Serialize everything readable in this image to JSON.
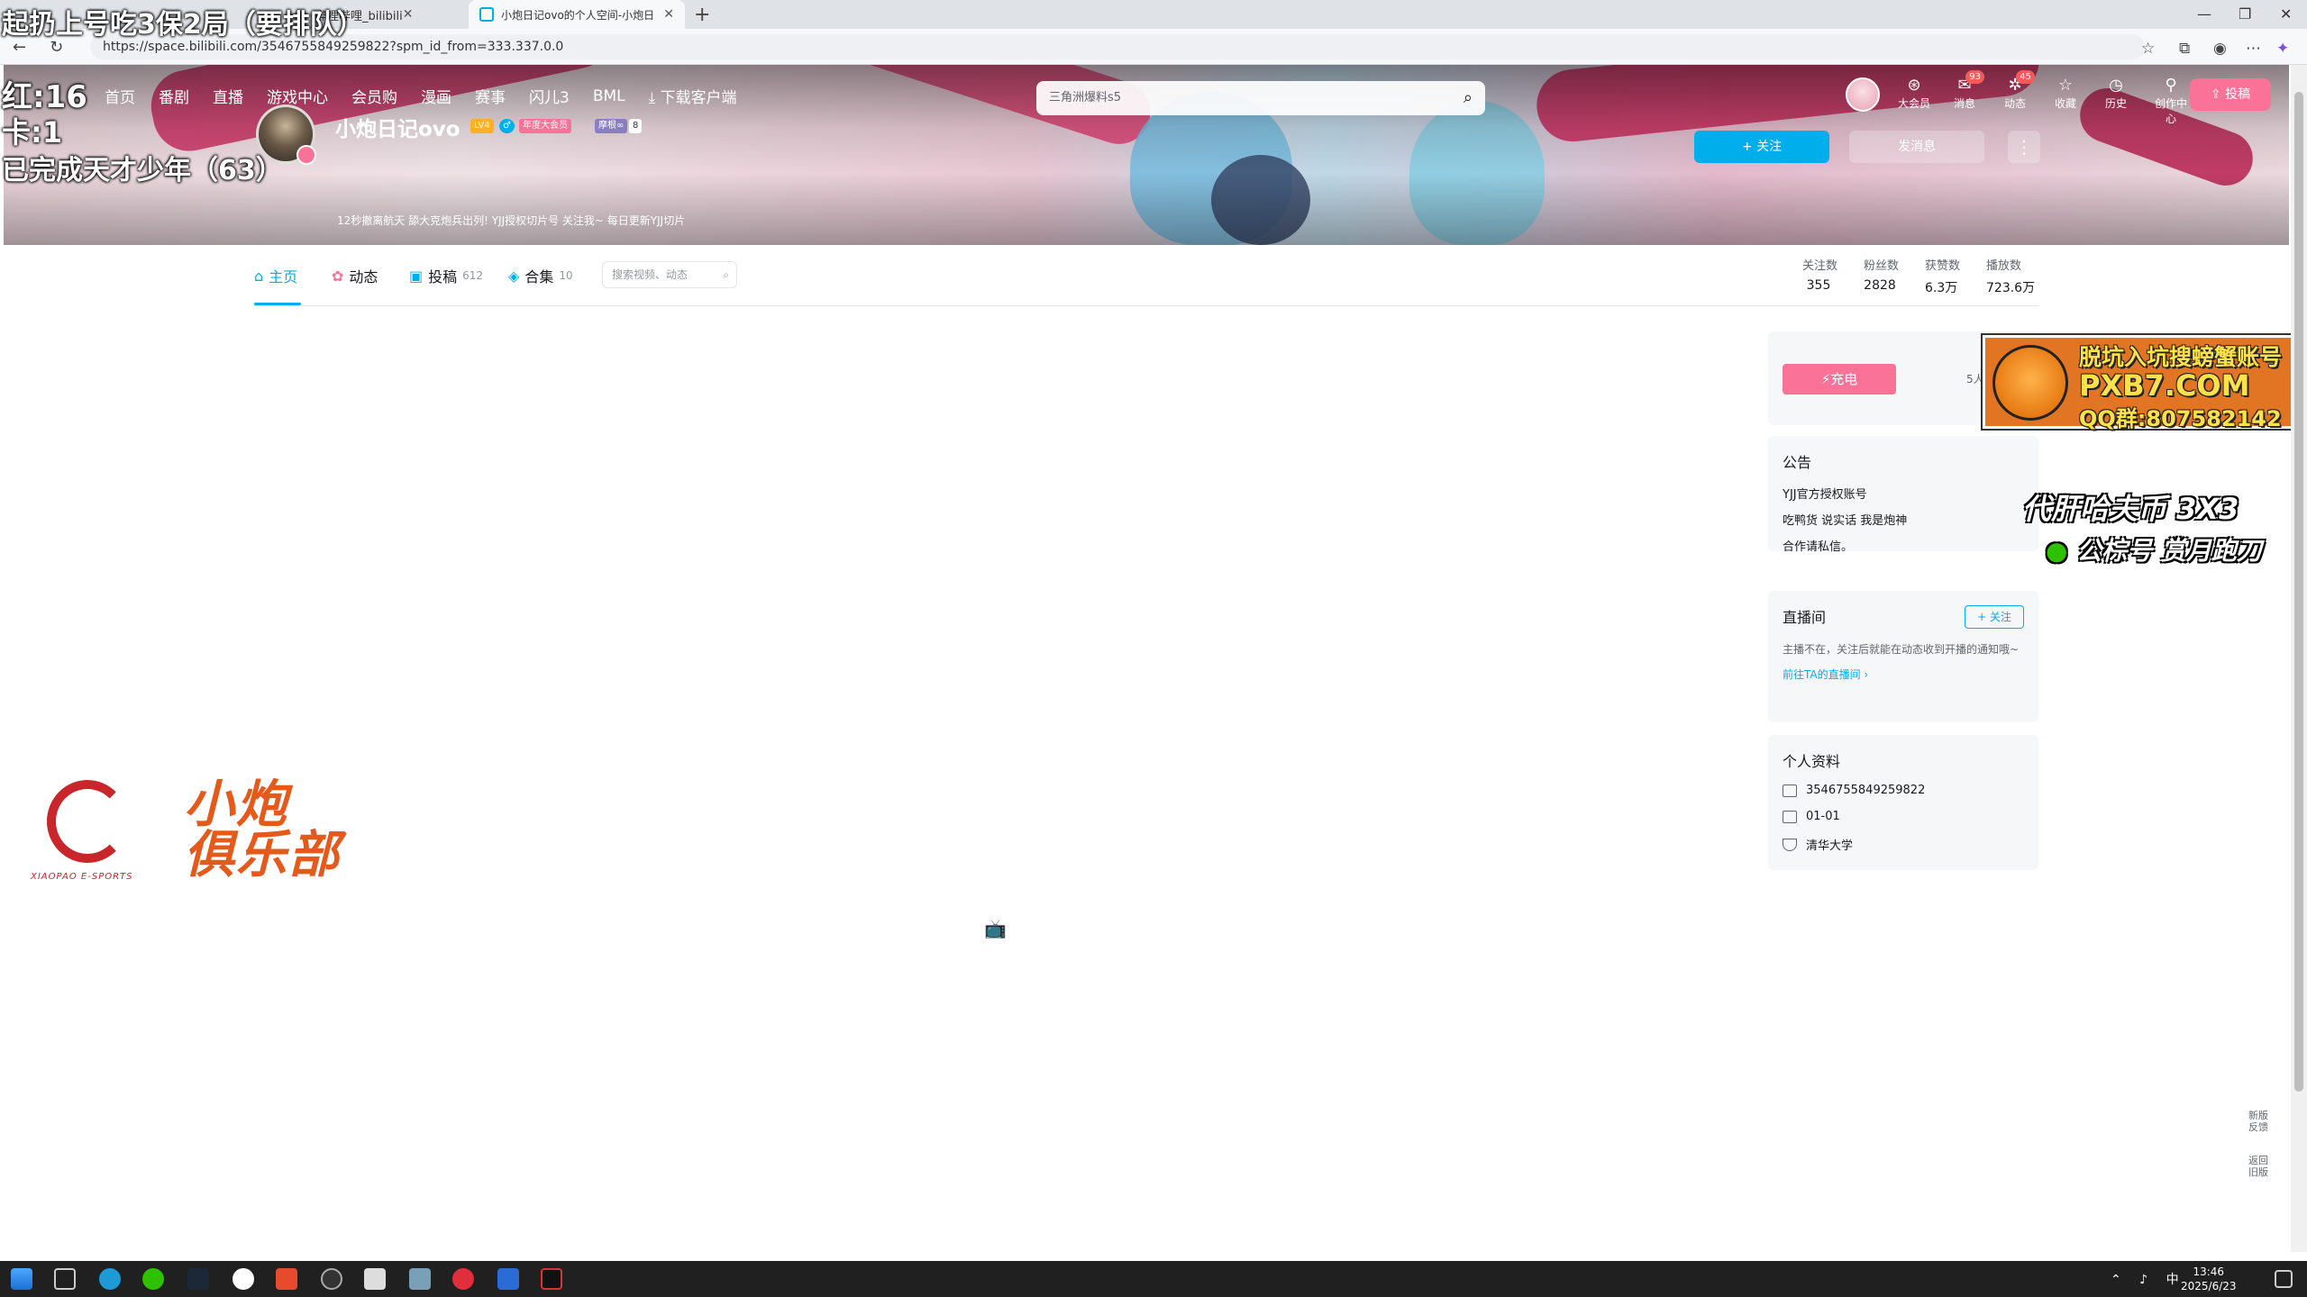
{
  "browser": {
    "tabs": [
      {
        "label": "哔哩哔哩 (゜-゜)つロ 干杯~-bilibili",
        "partial_label": "哔哩哔哩_bilibili"
      },
      {
        "label": "小炮日记ovo的个人空间-小炮日记"
      }
    ],
    "url": "https://space.bilibili.com/3546755849259822?spm_id_from=333.337.0.0"
  },
  "overlay": {
    "line1": "起扔上号吃3保2局（要排队）",
    "line2_label": "红:",
    "line2_value": "16",
    "line3_label": "卡:",
    "line3_value": "1",
    "line4": "已完成天才少年（63）"
  },
  "topnav": {
    "items": [
      "首页",
      "番剧",
      "直播",
      "游戏中心",
      "会员购",
      "漫画",
      "赛事",
      "闪儿3",
      "BML"
    ],
    "download": "下载客户端",
    "search_placeholder": "三角洲爆料s5",
    "right": [
      {
        "label": "大会员",
        "icon": "vip-icon"
      },
      {
        "label": "消息",
        "icon": "message-icon",
        "badge": "93"
      },
      {
        "label": "动态",
        "icon": "dynamic-icon",
        "badge": "45"
      },
      {
        "label": "收藏",
        "icon": "star-icon"
      },
      {
        "label": "历史",
        "icon": "history-icon"
      },
      {
        "label": "创作中心",
        "icon": "creator-icon"
      }
    ],
    "upload": "投稿"
  },
  "profile": {
    "name": "小炮日记ovo",
    "level": "LV4",
    "gender": "♂",
    "vip_tag": "年度大会员",
    "fan_tag": "摩根∞",
    "fan_level": "8",
    "sign": "12秒撤离航天  舔大克炮兵出列!  YJJ授权切片号  关注我~ 每日更新YJJ切片",
    "follow_btn": "+ 关注",
    "msg_btn": "发消息",
    "more": "⋮"
  },
  "tabs": {
    "items": [
      {
        "label": "主页",
        "count": ""
      },
      {
        "label": "动态",
        "count": ""
      },
      {
        "label": "投稿",
        "count": "612"
      },
      {
        "label": "合集",
        "count": "10"
      }
    ],
    "search_placeholder": "搜索视频、动态"
  },
  "stats": [
    {
      "key": "关注数",
      "value": "355"
    },
    {
      "key": "粉丝数",
      "value": "2828"
    },
    {
      "key": "获赞数",
      "value": "6.3万"
    },
    {
      "key": "播放数",
      "value": "723.6万"
    }
  ],
  "charge": {
    "button": "充电",
    "count_text": "5人"
  },
  "notice": {
    "title": "公告",
    "lines": [
      "YJJ官方授权账号",
      "吃鸭货 说实话 我是炮神",
      "合作请私信。"
    ]
  },
  "live": {
    "title": "直播间",
    "follow": "+ 关注",
    "text": "主播不在，关注后就能在动态收到开播的通知哦~",
    "link": "前往TA的直播间 ›"
  },
  "personal": {
    "title": "个人资料",
    "uid": "3546755849259822",
    "birthday": "01-01",
    "school": "清华大学"
  },
  "ad1": {
    "line1": "脱坑入坑搜螃蟹账号",
    "line2": "PXB7.COM",
    "line3": "QQ群:807582142"
  },
  "ad2": {
    "line1": "代肝哈夫币 3X3",
    "line2": "公棕号 赏月跑刀"
  },
  "logo": {
    "char1": "小炮",
    "char2": "俱乐部",
    "sub": "XIAOPAO E-SPORTS"
  },
  "sidefloat": {
    "feedback": "新版反馈",
    "old": "返回旧版"
  },
  "taskbar": {
    "time": "13:46",
    "date": "2025/6/23",
    "ime": "中"
  },
  "colors": {
    "accent": "#00aeec",
    "pink": "#fb7299"
  }
}
